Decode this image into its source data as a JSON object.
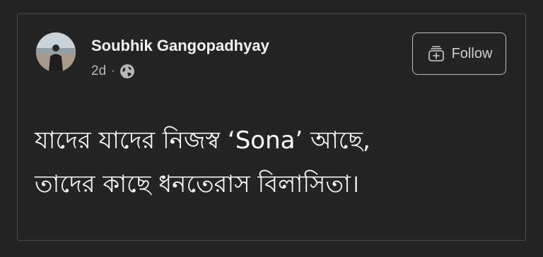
{
  "post": {
    "author": "Soubhik Gangopadhyay",
    "time": "2d",
    "separator": "·",
    "audience_icon": "globe-icon",
    "follow_label": "Follow",
    "follow_icon": "add-to-collection-icon",
    "text_lines": [
      "যাদের যাদের নিজস্ব ‘Sona’ আছে,",
      "তাদের কাছে ধনতেরাস বিলাসিতা।"
    ]
  },
  "colors": {
    "background": "#232323",
    "border": "#4a4a4a",
    "text": "#ffffff",
    "muted": "#b8b8b8"
  }
}
